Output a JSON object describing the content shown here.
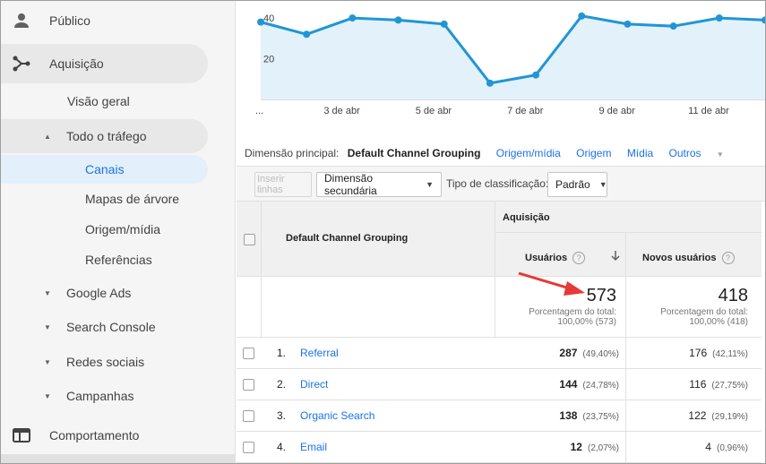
{
  "sidebar": {
    "items": [
      {
        "label": "Público",
        "icon": "person-icon"
      },
      {
        "label": "Aquisição",
        "icon": "acquisition-icon"
      },
      {
        "label": "Visão geral"
      },
      {
        "label": "Todo o tráfego"
      },
      {
        "label": "Canais"
      },
      {
        "label": "Mapas de árvore"
      },
      {
        "label": "Origem/mídia"
      },
      {
        "label": "Referências"
      },
      {
        "label": "Google Ads"
      },
      {
        "label": "Search Console"
      },
      {
        "label": "Redes sociais"
      },
      {
        "label": "Campanhas"
      },
      {
        "label": "Comportamento",
        "icon": "behavior-icon"
      }
    ]
  },
  "chart_data": {
    "type": "line",
    "x_ticks": [
      "...",
      "3 de abr",
      "5 de abr",
      "7 de abr",
      "9 de abr",
      "11 de abr"
    ],
    "y_ticks": [
      "40",
      "20"
    ],
    "ylim": [
      0,
      44
    ],
    "values": [
      38,
      32,
      40,
      39,
      37,
      8,
      12,
      41,
      37,
      36,
      40,
      39
    ],
    "line_color": "#2196d3",
    "fill_color": "#e3f1fb"
  },
  "dimension": {
    "label": "Dimensão principal:",
    "active": "Default Channel Grouping",
    "links": [
      "Origem/mídia",
      "Origem",
      "Mídia"
    ],
    "more": "Outros"
  },
  "toolbar": {
    "insert_rows": "Inserir linhas",
    "secondary_dimension": "Dimensão secundária",
    "sort_type_label": "Tipo de classificação:",
    "sort_type_value": "Padrão"
  },
  "table": {
    "dimension_header": "Default Channel Grouping",
    "group_header": "Aquisição",
    "col_users": "Usuários",
    "col_new_users": "Novos usuários",
    "total_users": "573",
    "total_users_sub1": "Porcentagem do total:",
    "total_users_sub2": "100,00% (573)",
    "total_new": "418",
    "total_new_sub1": "Porcentagem do total:",
    "total_new_sub2": "100,00% (418)",
    "rows": [
      {
        "rank": "1.",
        "channel": "Referral",
        "users": "287",
        "users_pct": "(49,40%)",
        "new": "176",
        "new_pct": "(42,11%)"
      },
      {
        "rank": "2.",
        "channel": "Direct",
        "users": "144",
        "users_pct": "(24,78%)",
        "new": "116",
        "new_pct": "(27,75%)"
      },
      {
        "rank": "3.",
        "channel": "Organic Search",
        "users": "138",
        "users_pct": "(23,75%)",
        "new": "122",
        "new_pct": "(29,19%)"
      },
      {
        "rank": "4.",
        "channel": "Email",
        "users": "12",
        "users_pct": "(2,07%)",
        "new": "4",
        "new_pct": "(0,96%)"
      }
    ]
  },
  "colors": {
    "accent": "#1a73e8",
    "arrow": "#e53935"
  }
}
